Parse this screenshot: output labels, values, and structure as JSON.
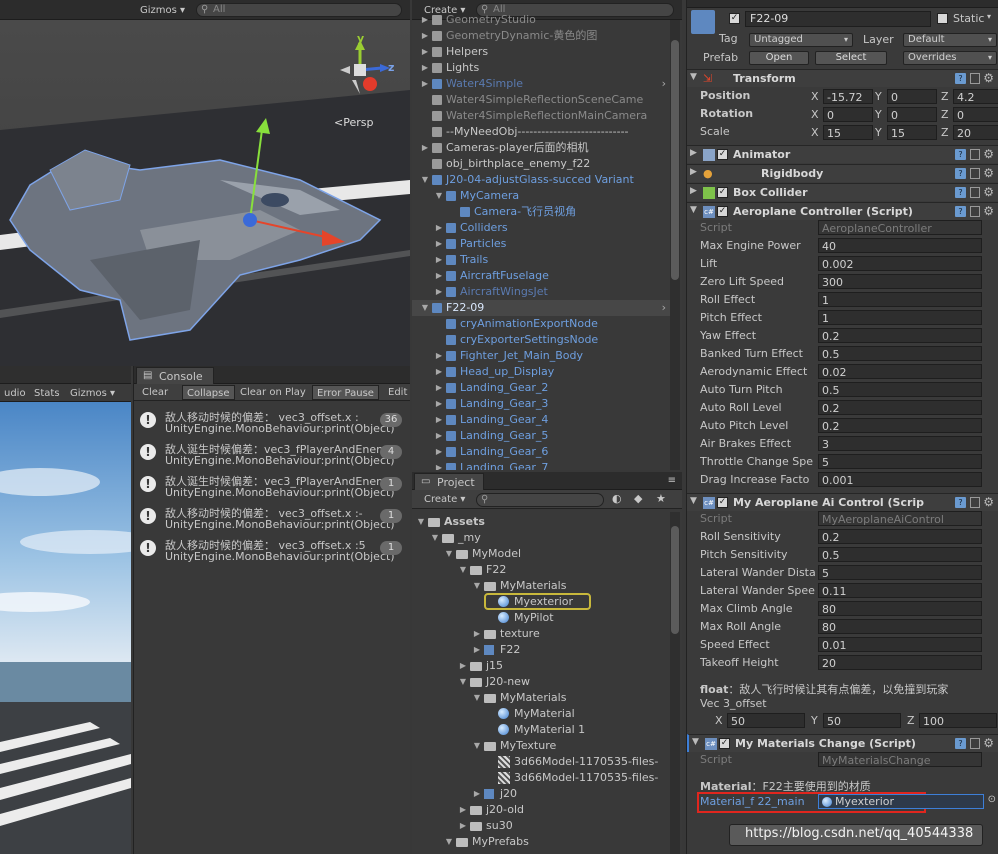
{
  "scene": {
    "gizmos_label": "Gizmos",
    "search_placeholder": "All",
    "persp_label": "Persp",
    "axis_y": "y",
    "axis_z": "z"
  },
  "hierarchy": {
    "create_label": "Create",
    "search_placeholder": "All",
    "items": [
      {
        "label": "GeometryStudio",
        "style": "faded"
      },
      {
        "label": "GeometryDynamic-黄色的图",
        "style": "faded"
      },
      {
        "label": "Helpers",
        "style": "normal"
      },
      {
        "label": "Lights",
        "style": "normal"
      },
      {
        "label": "Water4Simple",
        "style": "fadedblue"
      },
      {
        "label": "Water4SimpleReflectionSceneCame",
        "style": "faded"
      },
      {
        "label": "Water4SimpleReflectionMainCamera",
        "style": "faded"
      },
      {
        "label": "--MyNeedObj----------------------------",
        "style": "normal"
      },
      {
        "label": "Cameras-player后面的相机",
        "style": "normal"
      },
      {
        "label": "obj_birthplace_enemy_f22",
        "style": "normal"
      },
      {
        "label": "J20-04-adjustGlass-succed Variant",
        "style": "blue"
      },
      {
        "label": "MyCamera",
        "style": "blue"
      },
      {
        "label": "Camera-飞行员视角",
        "style": "blue"
      },
      {
        "label": "Colliders",
        "style": "blue"
      },
      {
        "label": "Particles",
        "style": "blue"
      },
      {
        "label": "Trails",
        "style": "blue"
      },
      {
        "label": "AircraftFuselage",
        "style": "blue"
      },
      {
        "label": "AircraftWingsJet",
        "style": "fadedblue"
      },
      {
        "label": "F22-09",
        "style": "selected"
      },
      {
        "label": "cryAnimationExportNode",
        "style": "blue"
      },
      {
        "label": "cryExporterSettingsNode",
        "style": "blue"
      },
      {
        "label": "Fighter_Jet_Main_Body",
        "style": "blue"
      },
      {
        "label": "Head_up_Display",
        "style": "blue"
      },
      {
        "label": "Landing_Gear_2",
        "style": "blue"
      },
      {
        "label": "Landing_Gear_3",
        "style": "blue"
      },
      {
        "label": "Landing_Gear_4",
        "style": "blue"
      },
      {
        "label": "Landing_Gear_5",
        "style": "blue"
      },
      {
        "label": "Landing_Gear_6",
        "style": "blue"
      },
      {
        "label": "Landing_Gear_7",
        "style": "blue"
      }
    ]
  },
  "game": {
    "tabs": [
      "udio",
      "Stats",
      "Gizmos"
    ]
  },
  "console": {
    "tab_label": "Console",
    "toolbar": [
      "Clear",
      "Collapse",
      "Clear on Play",
      "Error Pause",
      "Edit"
    ],
    "messages": [
      {
        "line1": "敌人移动时候的偏差：  vec3_offset.x :",
        "line2": "UnityEngine.MonoBehaviour:print(Object)",
        "count": "36"
      },
      {
        "line1": "敌人诞生时候偏差：vec3_fPlayerAndEnem",
        "line2": "UnityEngine.MonoBehaviour:print(Object)",
        "count": "4"
      },
      {
        "line1": "敌人诞生时候偏差：vec3_fPlayerAndEnem",
        "line2": "UnityEngine.MonoBehaviour:print(Object)",
        "count": "1"
      },
      {
        "line1": "敌人移动时候的偏差：  vec3_offset.x :-",
        "line2": "UnityEngine.MonoBehaviour:print(Object)",
        "count": "1"
      },
      {
        "line1": "敌人移动时候的偏差：  vec3_offset.x :5",
        "line2": "UnityEngine.MonoBehaviour:print(Object)",
        "count": "1"
      }
    ]
  },
  "project": {
    "tab_label": "Project",
    "create_label": "Create",
    "search_placeholder": "",
    "items": [
      {
        "label": "Assets",
        "kind": "folder",
        "depth": 0,
        "bold": true
      },
      {
        "label": "_my",
        "kind": "folder",
        "depth": 1
      },
      {
        "label": "MyModel",
        "kind": "folder",
        "depth": 2
      },
      {
        "label": "F22",
        "kind": "folder",
        "depth": 3
      },
      {
        "label": "MyMaterials",
        "kind": "folder",
        "depth": 4
      },
      {
        "label": "Myexterior",
        "kind": "material",
        "depth": 5,
        "highlight": true
      },
      {
        "label": "MyPilot",
        "kind": "material",
        "depth": 5
      },
      {
        "label": "texture",
        "kind": "folder",
        "depth": 4,
        "collapsed": true
      },
      {
        "label": "F22",
        "kind": "prefab",
        "depth": 4,
        "collapsed": true
      },
      {
        "label": "j15",
        "kind": "folder",
        "depth": 3,
        "collapsed": true
      },
      {
        "label": "J20-new",
        "kind": "folder",
        "depth": 3
      },
      {
        "label": "MyMaterials",
        "kind": "folder",
        "depth": 4
      },
      {
        "label": "MyMaterial",
        "kind": "material",
        "depth": 5
      },
      {
        "label": "MyMaterial 1",
        "kind": "material",
        "depth": 5
      },
      {
        "label": "MyTexture",
        "kind": "folder",
        "depth": 4
      },
      {
        "label": "3d66Model-1170535-files-",
        "kind": "texture",
        "depth": 5
      },
      {
        "label": "3d66Model-1170535-files-",
        "kind": "texture",
        "depth": 5
      },
      {
        "label": "j20",
        "kind": "prefab",
        "depth": 4,
        "collapsed": true
      },
      {
        "label": "j20-old",
        "kind": "folder",
        "depth": 3,
        "collapsed": true
      },
      {
        "label": "su30",
        "kind": "folder",
        "depth": 3,
        "collapsed": true
      },
      {
        "label": "MyPrefabs",
        "kind": "folder",
        "depth": 2
      }
    ]
  },
  "inspector": {
    "object_name": "F22-09",
    "static_label": "Static",
    "tag_label": "Tag",
    "tag_value": "Untagged",
    "layer_label": "Layer",
    "layer_value": "Default",
    "prefab_label": "Prefab",
    "open_label": "Open",
    "select_label": "Select",
    "overrides_label": "Overrides",
    "transform": {
      "title": "Transform",
      "position_label": "Position",
      "rotation_label": "Rotation",
      "scale_label": "Scale",
      "position": {
        "x": "-15.72",
        "y": "0",
        "z": "4.2"
      },
      "rotation": {
        "x": "0",
        "y": "0",
        "z": "0"
      },
      "scale": {
        "x": "15",
        "y": "15",
        "z": "20"
      }
    },
    "animator_title": "Animator",
    "rigidbody_title": "Rigidbody",
    "boxcollider_title": "Box Collider",
    "aeroplane_controller": {
      "title": "Aeroplane Controller (Script)",
      "props": [
        {
          "label": "Script",
          "value": "AeroplaneController",
          "disabled": true
        },
        {
          "label": "Max Engine Power",
          "value": "40"
        },
        {
          "label": "Lift",
          "value": "0.002"
        },
        {
          "label": "Zero Lift Speed",
          "value": "300"
        },
        {
          "label": "Roll Effect",
          "value": "1"
        },
        {
          "label": "Pitch Effect",
          "value": "1"
        },
        {
          "label": "Yaw Effect",
          "value": "0.2"
        },
        {
          "label": "Banked Turn Effect",
          "value": "0.5"
        },
        {
          "label": "Aerodynamic Effect",
          "value": "0.02"
        },
        {
          "label": "Auto Turn Pitch",
          "value": "0.5"
        },
        {
          "label": "Auto Roll Level",
          "value": "0.2"
        },
        {
          "label": "Auto Pitch Level",
          "value": "0.2"
        },
        {
          "label": "Air Brakes Effect",
          "value": "3"
        },
        {
          "label": "Throttle Change Spe",
          "value": "5"
        },
        {
          "label": "Drag Increase Facto",
          "value": "0.001"
        }
      ]
    },
    "ai_control": {
      "title": "My Aeroplane Ai Control (Scrip",
      "props": [
        {
          "label": "Script",
          "value": "MyAeroplaneAiControl",
          "disabled": true
        },
        {
          "label": "Roll Sensitivity",
          "value": "0.2"
        },
        {
          "label": "Pitch Sensitivity",
          "value": "0.5"
        },
        {
          "label": "Lateral Wander Dista",
          "value": "5"
        },
        {
          "label": "Lateral Wander Spee",
          "value": "0.11"
        },
        {
          "label": "Max Climb Angle",
          "value": "80"
        },
        {
          "label": "Max Roll Angle",
          "value": "80"
        },
        {
          "label": "Speed Effect",
          "value": "0.01"
        },
        {
          "label": "Takeoff Height",
          "value": "20"
        }
      ],
      "header_bold": "float",
      "header_rest": "：敌人飞行时候让其有点偏差，以免撞到玩家",
      "vec_label": "Vec 3_offset",
      "vec": {
        "x": "50",
        "y": "50",
        "z": "100"
      }
    },
    "materials_change": {
      "title": "My Materials Change (Script)",
      "script_label": "Script",
      "script_value": "MyMaterialsChange",
      "header_bold": "Material",
      "header_rest": "：F22主要使用到的材质",
      "field_label": "Material_f 22_main",
      "field_value": "Myexterior"
    },
    "watermark": "https://blog.csdn.net/qq_40544338"
  },
  "colors": {
    "highlight_red": "#e0261e",
    "highlight_yellow": "#c8b83c",
    "link_blue": "#6e9fe0"
  }
}
